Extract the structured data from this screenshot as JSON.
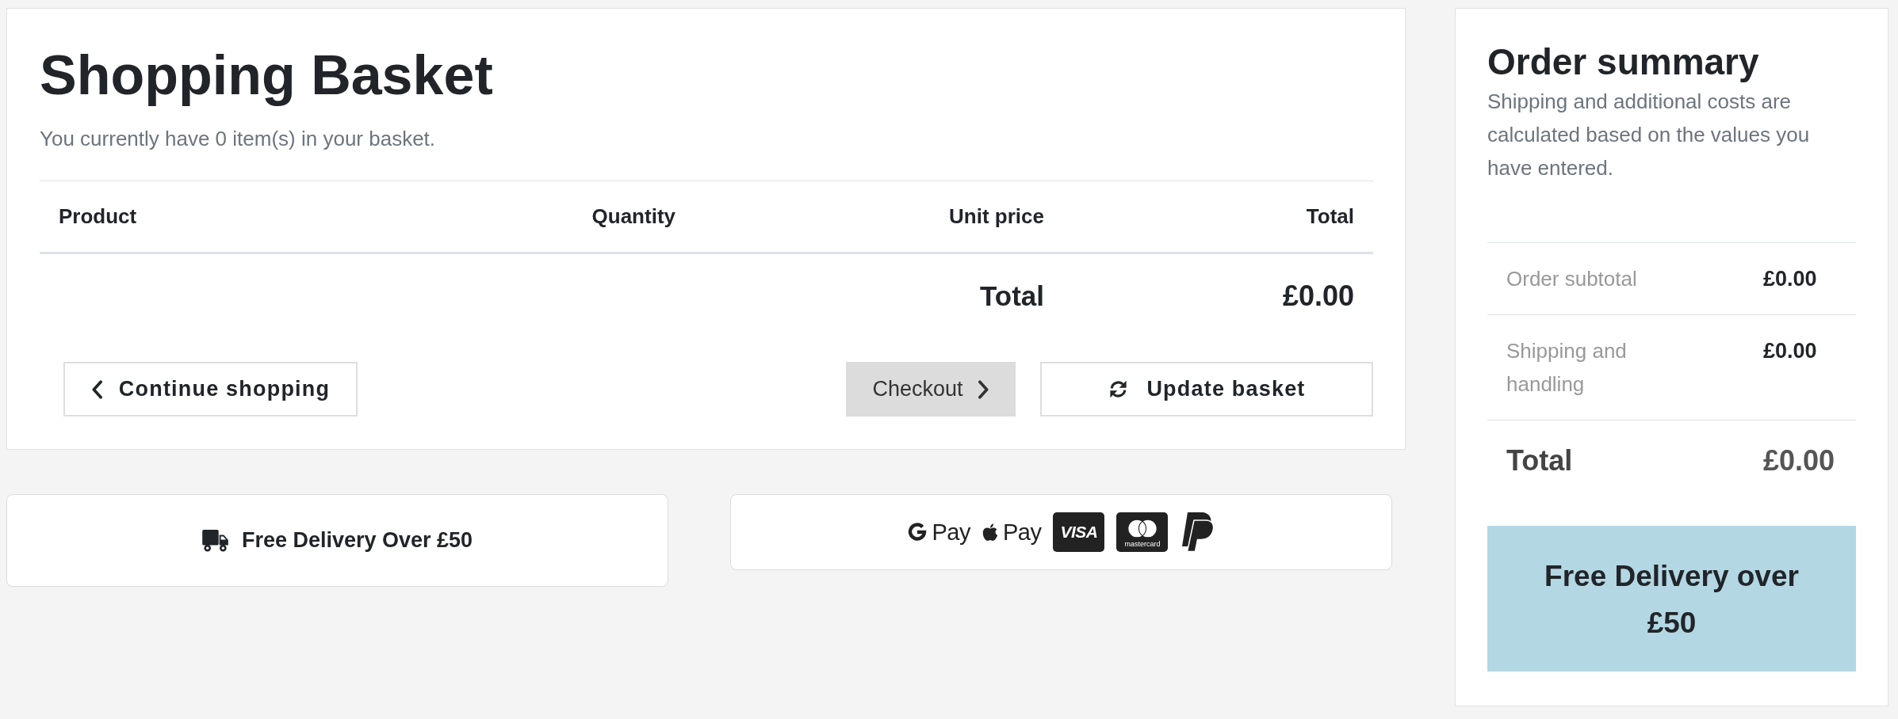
{
  "basket": {
    "title": "Shopping Basket",
    "subtitle": "You currently have 0 item(s) in your basket.",
    "columns": [
      "Product",
      "Quantity",
      "Unit price",
      "Total"
    ],
    "total": {
      "label": "Total",
      "value": "£0.00"
    },
    "buttons": [
      {
        "kind": "back",
        "label": "Continue shopping"
      },
      {
        "kind": "checkout",
        "label": "Checkout"
      },
      {
        "kind": "update",
        "label": "Update basket"
      }
    ]
  },
  "delivery_card": {
    "text": "Free Delivery Over £50"
  },
  "payment_methods": [
    {
      "kind": "google_pay",
      "label": "Pay"
    },
    {
      "kind": "apple_pay",
      "label": "Pay"
    },
    {
      "kind": "visa",
      "label": "VISA"
    },
    {
      "kind": "mastercard",
      "label": "mastercard"
    },
    {
      "kind": "paypal"
    }
  ],
  "order_summary": {
    "title": "Order summary",
    "note": "Shipping and additional costs are calculated based on the values you have entered.",
    "rows": [
      {
        "label": "Order subtotal",
        "value": "£0.00"
      },
      {
        "label": "Shipping and handling",
        "value": "£0.00"
      }
    ],
    "total": {
      "label": "Total",
      "value": "£0.00"
    },
    "banner": "Free Delivery over £50"
  }
}
